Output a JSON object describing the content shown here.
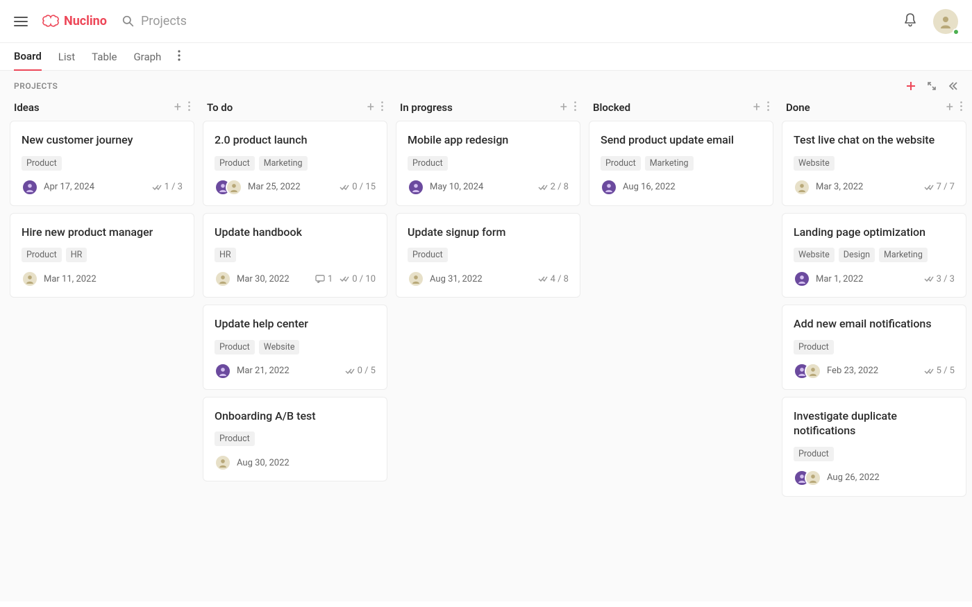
{
  "brand": {
    "name": "Nuclino"
  },
  "search": {
    "placeholder": "Projects"
  },
  "tabs": [
    {
      "key": "board",
      "label": "Board",
      "active": true
    },
    {
      "key": "list",
      "label": "List"
    },
    {
      "key": "table",
      "label": "Table"
    },
    {
      "key": "graph",
      "label": "Graph"
    }
  ],
  "board": {
    "title": "PROJECTS",
    "columns": [
      {
        "key": "ideas",
        "name": "Ideas",
        "cards": [
          {
            "title": "New customer journey",
            "tags": [
              "Product"
            ],
            "avatars": [
              "purple"
            ],
            "date": "Apr 17, 2024",
            "checklist": "1 / 3"
          },
          {
            "title": "Hire new product manager",
            "tags": [
              "Product",
              "HR"
            ],
            "avatars": [
              "tan"
            ],
            "date": "Mar 11, 2022"
          }
        ]
      },
      {
        "key": "todo",
        "name": "To do",
        "cards": [
          {
            "title": "2.0 product launch",
            "tags": [
              "Product",
              "Marketing"
            ],
            "avatars": [
              "purple",
              "tan"
            ],
            "date": "Mar 25, 2022",
            "checklist": "0 / 15"
          },
          {
            "title": "Update handbook",
            "tags": [
              "HR"
            ],
            "avatars": [
              "tan"
            ],
            "date": "Mar 30, 2022",
            "comments": "1",
            "checklist": "0 / 10"
          },
          {
            "title": "Update help center",
            "tags": [
              "Product",
              "Website"
            ],
            "avatars": [
              "purple"
            ],
            "date": "Mar 21, 2022",
            "checklist": "0 / 5"
          },
          {
            "title": "Onboarding A/B test",
            "tags": [
              "Product"
            ],
            "avatars": [
              "tan"
            ],
            "date": "Aug 30, 2022"
          }
        ]
      },
      {
        "key": "inprogress",
        "name": "In progress",
        "cards": [
          {
            "title": "Mobile app redesign",
            "tags": [
              "Product"
            ],
            "avatars": [
              "purple"
            ],
            "date": "May 10, 2024",
            "checklist": "2 / 8"
          },
          {
            "title": "Update signup form",
            "tags": [
              "Product"
            ],
            "avatars": [
              "tan"
            ],
            "date": "Aug 31, 2022",
            "checklist": "4 / 8"
          }
        ]
      },
      {
        "key": "blocked",
        "name": "Blocked",
        "cards": [
          {
            "title": "Send product update email",
            "tags": [
              "Product",
              "Marketing"
            ],
            "avatars": [
              "purple"
            ],
            "date": "Aug 16, 2022"
          }
        ]
      },
      {
        "key": "done",
        "name": "Done",
        "cards": [
          {
            "title": "Test live chat on the website",
            "tags": [
              "Website"
            ],
            "avatars": [
              "tan"
            ],
            "date": "Mar 3, 2022",
            "checklist": "7 / 7"
          },
          {
            "title": "Landing page optimization",
            "tags": [
              "Website",
              "Design",
              "Marketing"
            ],
            "avatars": [
              "purple"
            ],
            "date": "Mar 1, 2022",
            "checklist": "3 / 3"
          },
          {
            "title": "Add new email notifications",
            "tags": [
              "Product"
            ],
            "avatars": [
              "purple",
              "tan"
            ],
            "date": "Feb 23, 2022",
            "checklist": "5 / 5"
          },
          {
            "title": "Investigate duplicate notifications",
            "tags": [
              "Product"
            ],
            "avatars": [
              "purple",
              "tan"
            ],
            "date": "Aug 26, 2022"
          }
        ]
      }
    ]
  }
}
